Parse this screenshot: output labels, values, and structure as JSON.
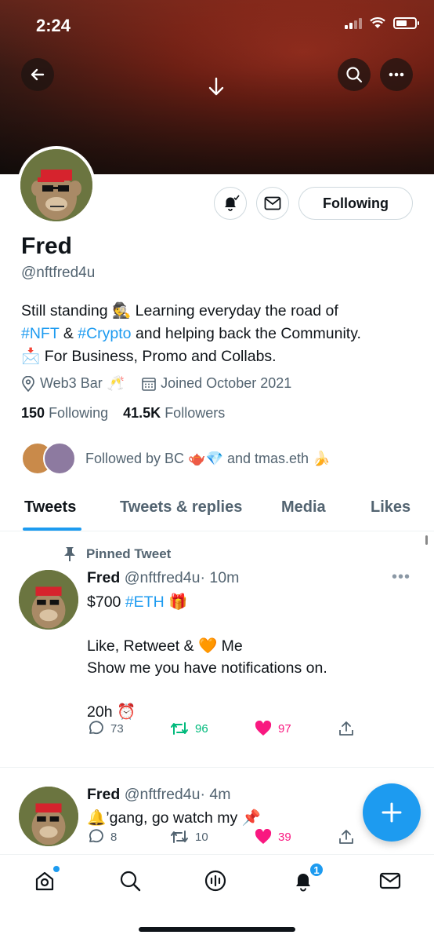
{
  "status_bar": {
    "time": "2:24"
  },
  "profile": {
    "name": "Fred",
    "handle": "@nftfred4u",
    "following_button": "Following",
    "bio_line1_a": "Still standing ",
    "bio_line1_b": " Learning everyday the road of",
    "bio_tag1": "#NFT",
    "bio_amp": " & ",
    "bio_tag2": "#Crypto",
    "bio_line2_rest": " and helping back the Community.",
    "bio_line3": " For Business, Promo and Collabs.",
    "location": "Web3 Bar",
    "joined": "Joined October 2021",
    "following_count": "150",
    "following_label": "Following",
    "followers_count": "41.5K",
    "followers_label": "Followers",
    "followed_by_a": "Followed by BC",
    "followed_by_b": "and tmas.eth"
  },
  "tabs": [
    "Tweets",
    "Tweets & replies",
    "Media",
    "Likes"
  ],
  "pinned_label": "Pinned Tweet",
  "tweets": [
    {
      "name": "Fred",
      "handle": "@nftfred4u",
      "time": "· 10m",
      "line1_a": "$700 ",
      "line1_tag": "#ETH",
      "line2_a": "Like, Retweet & ",
      "line2_b": " Me",
      "line3": "Show me you have notifications on.",
      "line4": "20h",
      "replies": "73",
      "retweets": "96",
      "likes": "97"
    },
    {
      "name": "Fred",
      "handle": "@nftfred4u",
      "time": "· 4m",
      "line1": "’gang, go watch my",
      "replies": "8",
      "retweets": "10",
      "likes": "39"
    }
  ],
  "nav": {
    "notifications_badge": "1"
  },
  "colors": {
    "accent": "#1d9bf0",
    "retweet": "#00ba7c",
    "like": "#f91880",
    "muted": "#536471"
  }
}
